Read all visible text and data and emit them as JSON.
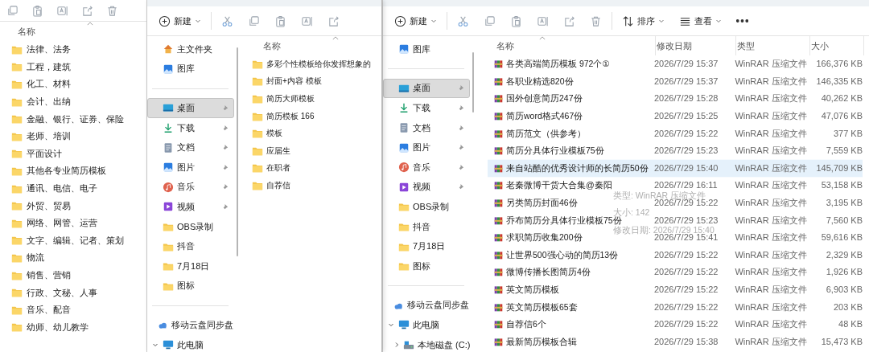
{
  "windows": [
    {
      "toolbar": [
        {
          "kind": "copy",
          "disabled": true
        },
        {
          "kind": "paste",
          "disabled": true
        },
        {
          "kind": "rename",
          "disabled": true
        },
        {
          "kind": "share",
          "disabled": true
        },
        {
          "kind": "delete",
          "disabled": true
        }
      ],
      "column_header": "名称",
      "folders": [
        "法律、法务",
        "工程，建筑",
        "化工、材料",
        "会计、出纳",
        "金融、银行、证券、保险",
        "老师、培训",
        "平面设计",
        "其他各专业简历模板",
        "通讯、电信、电子",
        "外贸、贸易",
        "网络、网管、运营",
        "文字、编辑、记者、策划",
        "物流",
        "销售、营销",
        "行政、文秘、人事",
        "音乐、配音",
        "幼师、幼儿教学"
      ]
    },
    {
      "toolbar": [
        {
          "kind": "new",
          "label": "新建"
        },
        {
          "kind": "cut",
          "disabled": true
        },
        {
          "kind": "copy",
          "disabled": true
        },
        {
          "kind": "paste",
          "disabled": true
        },
        {
          "kind": "rename",
          "disabled": true
        },
        {
          "kind": "share",
          "disabled": true
        }
      ],
      "nav_sections": [
        [
          {
            "label": "主文件夹",
            "kind": "home",
            "selected": false
          },
          {
            "label": "图库",
            "kind": "gallery",
            "selected": false
          }
        ],
        [
          {
            "label": "桌面",
            "kind": "desktop",
            "selected": true,
            "pinned": true
          },
          {
            "label": "下载",
            "kind": "download",
            "selected": false,
            "pinned": true
          },
          {
            "label": "文档",
            "kind": "documents",
            "selected": false,
            "pinned": true
          },
          {
            "label": "图片",
            "kind": "pictures",
            "selected": false,
            "pinned": true
          },
          {
            "label": "音乐",
            "kind": "music",
            "selected": false,
            "pinned": true
          },
          {
            "label": "视频",
            "kind": "videos",
            "selected": false,
            "pinned": true
          },
          {
            "label": "OBS录制",
            "kind": "folder",
            "selected": false,
            "pinned": false
          },
          {
            "label": "抖音",
            "kind": "folder",
            "selected": false,
            "pinned": false
          },
          {
            "label": "7月18日",
            "kind": "folder",
            "selected": false,
            "pinned": false
          },
          {
            "label": "图标",
            "kind": "folder",
            "selected": false,
            "pinned": false
          }
        ],
        [
          {
            "label": "移动云盘同步盘",
            "kind": "cloud",
            "selected": false
          },
          {
            "label": "此电脑",
            "kind": "pc",
            "selected": false,
            "expanded": true
          }
        ]
      ],
      "column_header": "名称",
      "folders": [
        "多彩个性模板给你发挥想象的",
        "封面+内容 模板",
        "简历大师模板",
        "简历模板 166",
        "模板",
        "应届生",
        "在职者",
        "自荐信"
      ]
    },
    {
      "toolbar": [
        {
          "kind": "new",
          "label": "新建"
        },
        {
          "kind": "cut",
          "disabled": true
        },
        {
          "kind": "copy",
          "disabled": true
        },
        {
          "kind": "paste",
          "disabled": true
        },
        {
          "kind": "rename",
          "disabled": true
        },
        {
          "kind": "share",
          "disabled": true
        },
        {
          "kind": "delete",
          "disabled": true
        },
        {
          "kind": "sort",
          "label": "排序"
        },
        {
          "kind": "view",
          "label": "查看"
        },
        {
          "kind": "more"
        }
      ],
      "nav_sections": [
        [
          {
            "label": "图库",
            "kind": "gallery",
            "selected": false
          }
        ],
        [
          {
            "label": "桌面",
            "kind": "desktop",
            "selected": true,
            "pinned": true
          },
          {
            "label": "下载",
            "kind": "download",
            "selected": false,
            "pinned": true
          },
          {
            "label": "文档",
            "kind": "documents",
            "selected": false,
            "pinned": true
          },
          {
            "label": "图片",
            "kind": "pictures",
            "selected": false,
            "pinned": true
          },
          {
            "label": "音乐",
            "kind": "music",
            "selected": false,
            "pinned": true
          },
          {
            "label": "视频",
            "kind": "videos",
            "selected": false,
            "pinned": true
          },
          {
            "label": "OBS录制",
            "kind": "folder",
            "selected": false,
            "pinned": false
          },
          {
            "label": "抖音",
            "kind": "folder",
            "selected": false,
            "pinned": false
          },
          {
            "label": "7月18日",
            "kind": "folder",
            "selected": false,
            "pinned": false
          },
          {
            "label": "图标",
            "kind": "folder",
            "selected": false,
            "pinned": false
          }
        ],
        [
          {
            "label": "移动云盘同步盘",
            "kind": "cloud",
            "selected": false
          },
          {
            "label": "此电脑",
            "kind": "pc",
            "selected": false,
            "expanded": true,
            "children": [
              {
                "label": "本地磁盘 (C:)",
                "kind": "drive",
                "selected": false,
                "expanded": false
              }
            ]
          }
        ]
      ],
      "columns": [
        "名称",
        "修改日期",
        "类型",
        "大小"
      ],
      "rows": [
        {
          "name": "各类高端简历模板 972个①",
          "date": "2026/7/29 15:37",
          "type": "WinRAR 压缩文件",
          "size": "166,376 KB",
          "selected": false
        },
        {
          "name": "各职业精选820份",
          "date": "2026/7/29 15:37",
          "type": "WinRAR 压缩文件",
          "size": "146,335 KB",
          "selected": false
        },
        {
          "name": "国外创意简历247份",
          "date": "2026/7/29 15:28",
          "type": "WinRAR 压缩文件",
          "size": "40,262 KB",
          "selected": false
        },
        {
          "name": "简历word格式467份",
          "date": "2026/7/29 15:25",
          "type": "WinRAR 压缩文件",
          "size": "47,076 KB",
          "selected": false
        },
        {
          "name": "简历范文（供参考）",
          "date": "2026/7/29 15:22",
          "type": "WinRAR 压缩文件",
          "size": "377 KB",
          "selected": false
        },
        {
          "name": "简历分具体行业模板75份",
          "date": "2026/7/29 15:23",
          "type": "WinRAR 压缩文件",
          "size": "7,559 KB",
          "selected": false
        },
        {
          "name": "来自站酷的优秀设计师的长简历50份",
          "date": "2026/7/29 15:40",
          "type": "WinRAR 压缩文件",
          "size": "145,709 KB",
          "selected": true
        },
        {
          "name": "老秦微博干货大合集@秦阳",
          "date": "2026/7/29 16:11",
          "type": "WinRAR 压缩文件",
          "size": "53,158 KB",
          "selected": false
        },
        {
          "name": "另类简历封面46份",
          "date": "2026/7/29 15:22",
          "type": "WinRAR 压缩文件",
          "size": "3,195 KB",
          "selected": false
        },
        {
          "name": "乔布简历分具体行业模板75份",
          "date": "2026/7/29 15:23",
          "type": "WinRAR 压缩文件",
          "size": "7,560 KB",
          "selected": false
        },
        {
          "name": "求职简历收集200份",
          "date": "2026/7/29 15:41",
          "type": "WinRAR 压缩文件",
          "size": "59,616 KB",
          "selected": false
        },
        {
          "name": "让世界500强心动的简历13份",
          "date": "2026/7/29 15:22",
          "type": "WinRAR 压缩文件",
          "size": "2,329 KB",
          "selected": false
        },
        {
          "name": "微博传播长图简历4份",
          "date": "2026/7/29 15:22",
          "type": "WinRAR 压缩文件",
          "size": "1,926 KB",
          "selected": false
        },
        {
          "name": "英文简历模板",
          "date": "2026/7/29 15:22",
          "type": "WinRAR 压缩文件",
          "size": "6,903 KB",
          "selected": false
        },
        {
          "name": "英文简历模板65套",
          "date": "2026/7/29 15:22",
          "type": "WinRAR 压缩文件",
          "size": "203 KB",
          "selected": false
        },
        {
          "name": "自荐信6个",
          "date": "2026/7/29 15:22",
          "type": "WinRAR 压缩文件",
          "size": "48 KB",
          "selected": false
        },
        {
          "name": "最新简历模板合辑",
          "date": "2026/7/29 15:38",
          "type": "WinRAR 压缩文件",
          "size": "15,473 KB",
          "selected": false
        }
      ],
      "tooltip": {
        "lines": [
          "类型: WinRAR 压缩文件",
          "大小: 142",
          "修改日期: 2026/7/29 15:40"
        ]
      }
    }
  ]
}
